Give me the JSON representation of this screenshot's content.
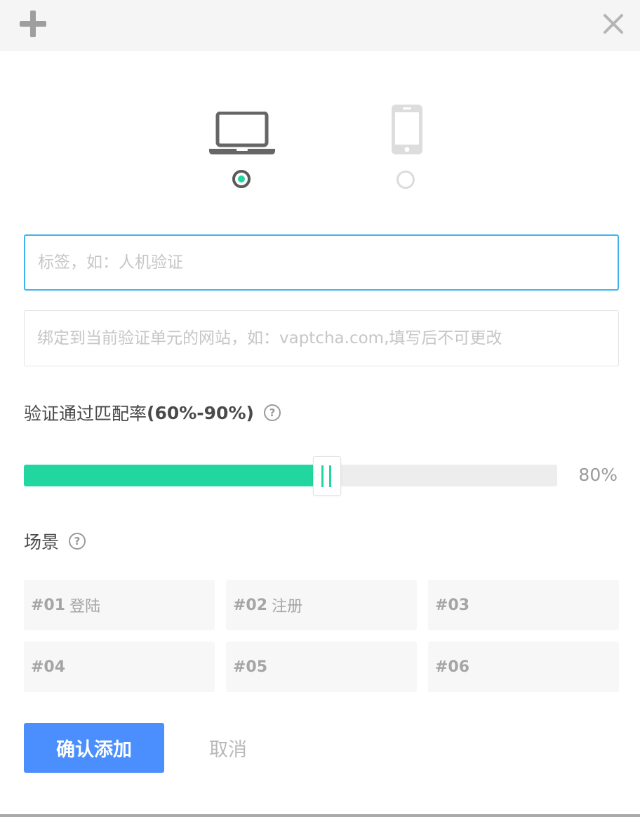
{
  "header": {
    "add_icon": "plus-icon",
    "close_icon": "close-icon"
  },
  "device_type": {
    "options": [
      {
        "icon": "laptop-icon",
        "selected": true,
        "color": "#666666"
      },
      {
        "icon": "mobile-phone-icon",
        "selected": false,
        "color": "#dddddd"
      }
    ]
  },
  "form": {
    "label_field": {
      "placeholder": "标签，如：人机验证",
      "value": "",
      "focused": true
    },
    "website_field": {
      "placeholder": "绑定到当前验证单元的网站，如：vaptcha.com,填写后不可更改",
      "value": ""
    }
  },
  "match_rate": {
    "title_prefix": "验证通过匹配率",
    "title_range": "(60%-90%)",
    "help_icon": "question-icon",
    "help_glyph": "?",
    "value_percent": 80,
    "value_label": "80%",
    "fill_fraction": 0.56
  },
  "scenes": {
    "title": "场景",
    "help_icon": "question-icon",
    "help_glyph": "?",
    "items": [
      {
        "num": "#01",
        "label": "登陆"
      },
      {
        "num": "#02",
        "label": "注册"
      },
      {
        "num": "#03",
        "label": ""
      },
      {
        "num": "#04",
        "label": ""
      },
      {
        "num": "#05",
        "label": ""
      },
      {
        "num": "#06",
        "label": ""
      }
    ]
  },
  "actions": {
    "confirm_label": "确认添加",
    "cancel_label": "取消"
  },
  "colors": {
    "accent_green": "#22d79f",
    "primary_blue": "#4a8ffd",
    "focus_border": "#3fb3f2"
  }
}
